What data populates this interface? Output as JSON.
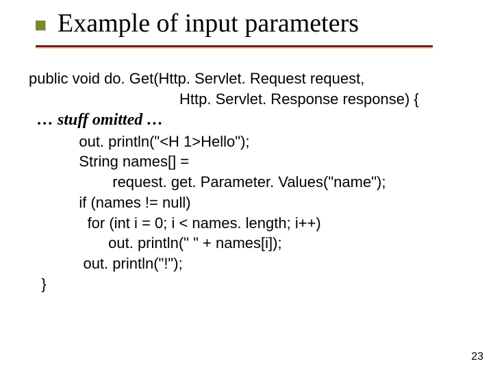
{
  "title": "Example of input parameters",
  "code": {
    "l1": "public void do. Get(Http. Servlet. Request request,",
    "l2": "                                    Http. Servlet. Response response) {",
    "stuff": "  … stuff omitted …",
    "l3": "            out. println(\"<H 1>Hello\");",
    "l4": "            String names[] =",
    "l5": "                    request. get. Parameter. Values(\"name\");",
    "l6": "            if (names != null)",
    "l7": "              for (int i = 0; i < names. length; i++)",
    "l8": "                   out. println(\" \" + names[i]);",
    "l9": "             out. println(\"!\");",
    "l10": "   }"
  },
  "page_number": "23"
}
